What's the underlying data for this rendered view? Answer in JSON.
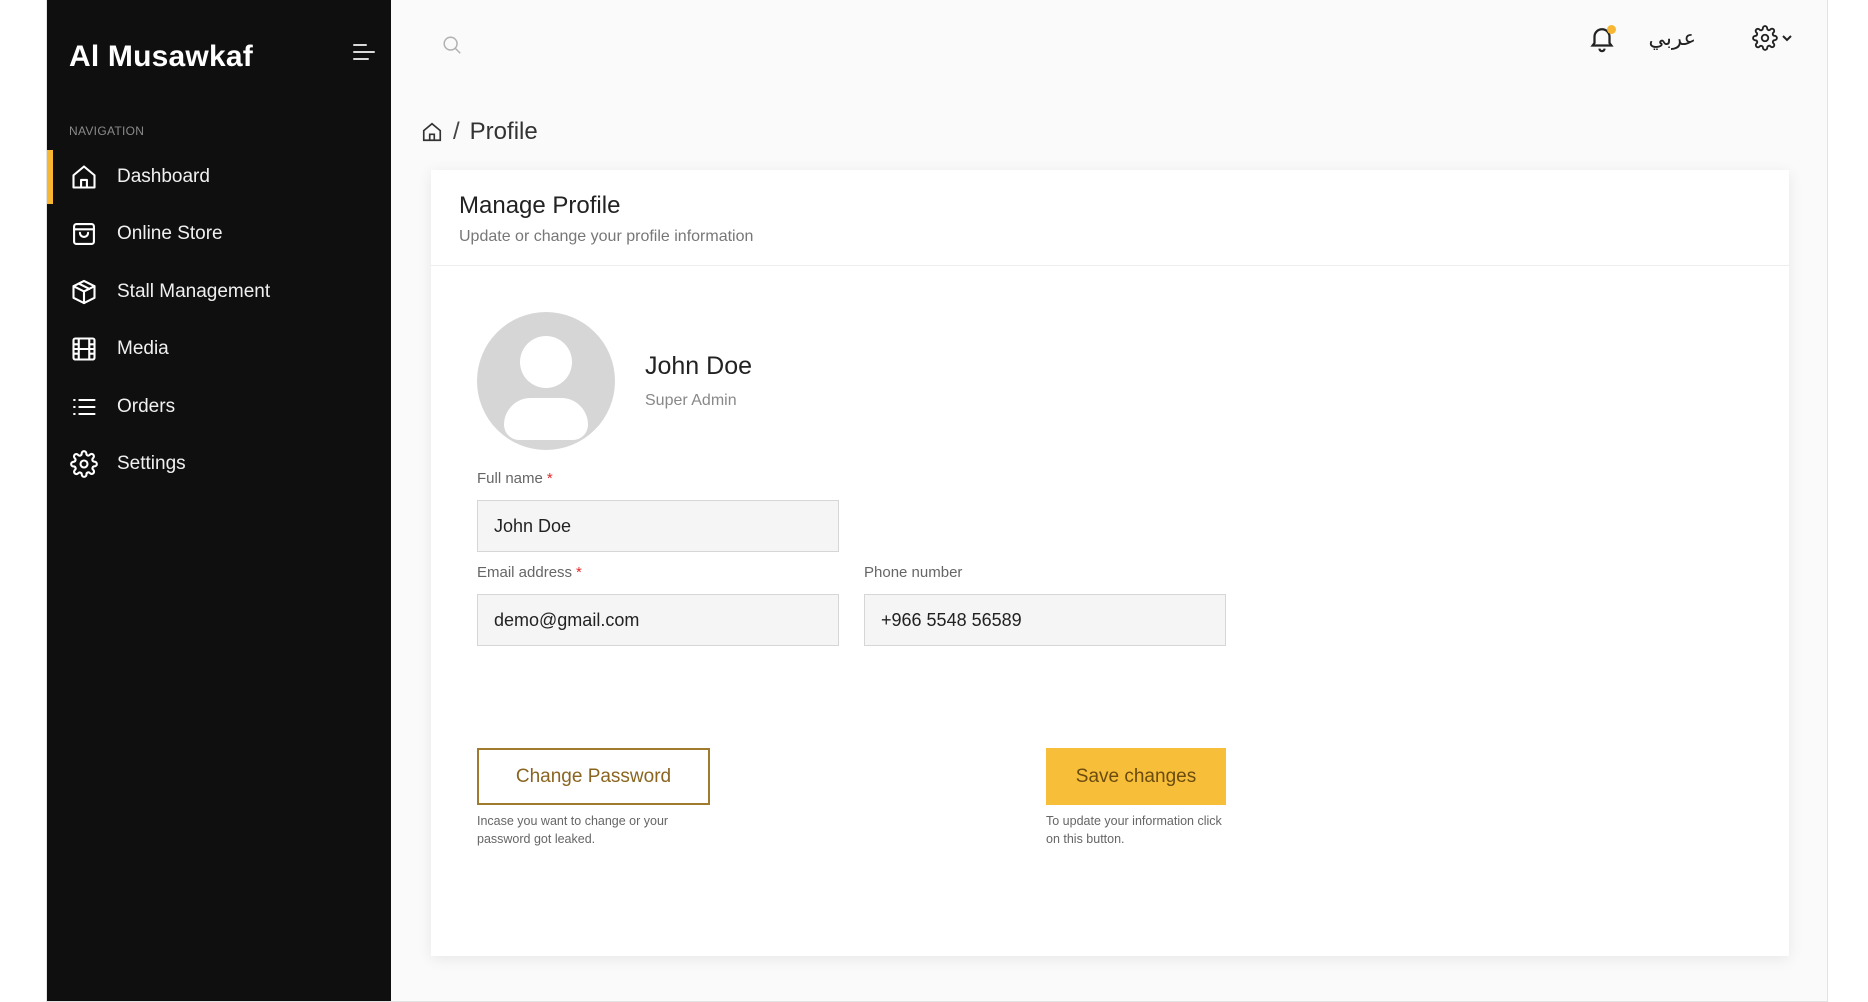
{
  "sidebar": {
    "brand": "Al Musawkaf",
    "nav_heading": "NAVIGATION",
    "items": [
      {
        "label": "Dashboard",
        "icon": "home-icon",
        "active": true
      },
      {
        "label": "Online Store",
        "icon": "shopping-bag-icon",
        "active": false
      },
      {
        "label": "Stall Management",
        "icon": "box-icon",
        "active": false
      },
      {
        "label": "Media",
        "icon": "film-icon",
        "active": false
      },
      {
        "label": "Orders",
        "icon": "list-icon",
        "active": false
      },
      {
        "label": "Settings",
        "icon": "gear-icon",
        "active": false
      }
    ]
  },
  "topbar": {
    "language_label": "عربي",
    "notification_dot": true
  },
  "breadcrumb": {
    "separator": "/",
    "current": "Profile"
  },
  "card": {
    "title": "Manage Profile",
    "subtitle": "Update or change your profile information"
  },
  "profile": {
    "name": "John Doe",
    "role": "Super Admin"
  },
  "form": {
    "full_name": {
      "label": "Full name",
      "required_mark": "*",
      "value": "John Doe"
    },
    "email": {
      "label": "Email address",
      "required_mark": "*",
      "value": "demo@gmail.com"
    },
    "phone": {
      "label": "Phone number",
      "value": "+966 5548 56589"
    }
  },
  "actions": {
    "change_password": {
      "label": "Change Password",
      "hint": "Incase you want to change or your password got leaked."
    },
    "save": {
      "label": "Save changes",
      "hint": "To update your information click on this button."
    }
  },
  "colors": {
    "accent": "#f7b733",
    "sidebar_bg": "#0f0f0f",
    "required": "#e02a2a",
    "outline_button": "#a07a2d"
  }
}
